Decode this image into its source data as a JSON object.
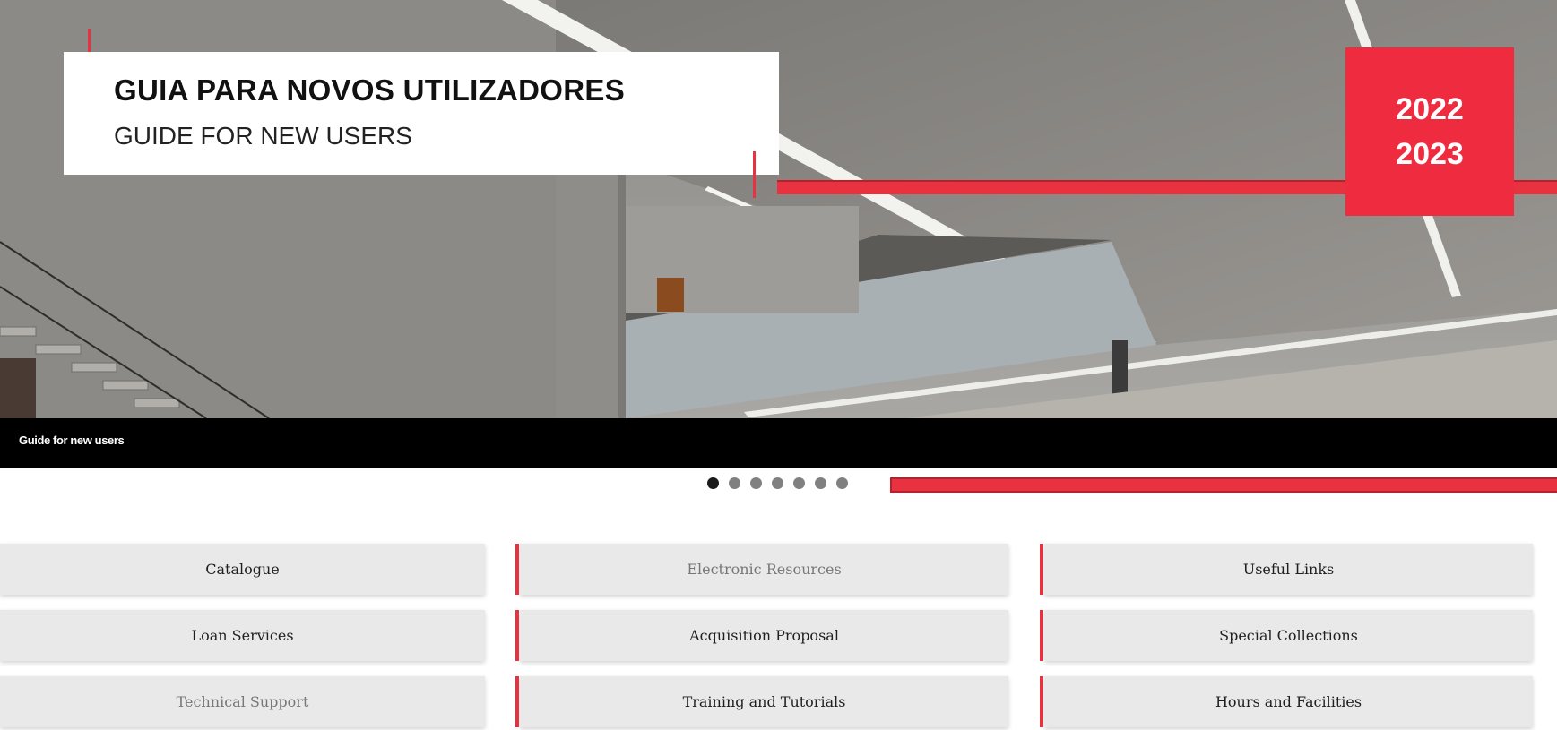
{
  "hero": {
    "title": "GUIA PARA NOVOS UTILIZADORES",
    "subtitle": "GUIDE FOR NEW USERS",
    "year_start": "2022",
    "year_end": "2023",
    "caption": "Guide for new users"
  },
  "carousel": {
    "slide_count": 7,
    "active_index": 0
  },
  "links": [
    {
      "label": "Catalogue"
    },
    {
      "label": "Electronic Resources"
    },
    {
      "label": "Useful Links"
    },
    {
      "label": "Loan Services"
    },
    {
      "label": "Acquisition Proposal"
    },
    {
      "label": "Special Collections"
    },
    {
      "label": "Technical Support"
    },
    {
      "label": "Training and Tutorials"
    },
    {
      "label": "Hours and Facilities"
    }
  ],
  "colors": {
    "accent": "#ef2c3f",
    "tile_bg": "#e9e9e9",
    "caption_bg": "#000000"
  }
}
